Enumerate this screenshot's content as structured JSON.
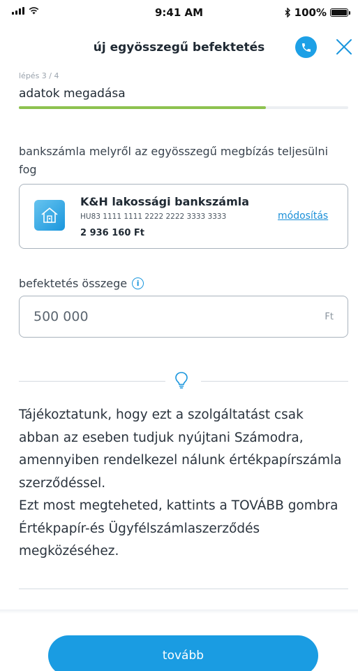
{
  "status_bar": {
    "time": "9:41 AM",
    "battery": "100%",
    "icons": [
      "signal-icon",
      "wifi-icon",
      "bluetooth-icon",
      "battery-icon"
    ]
  },
  "header": {
    "title": "új egyösszegű befektetés",
    "icons": [
      "phone-icon",
      "close-icon"
    ],
    "accent_color": "#1a9ce2"
  },
  "step": {
    "label": "lépés 3 / 4",
    "title": "adatok megadása",
    "progress": 0.75,
    "progress_color": "#8dc24f"
  },
  "account": {
    "label": "bankszámla melyről az egyösszegű megbízás teljesülni fog",
    "name": "K&H lakossági bankszámla",
    "iban": "HU83 1111 1111 2222 2222 3333 3333",
    "balance": "2 936 160 Ft",
    "modify_label": "módosítás",
    "icon": "house-account-icon"
  },
  "amount": {
    "label": "befektetés összege",
    "value": "500 000",
    "currency": "Ft",
    "icon": "info-icon"
  },
  "notice": {
    "icon": "lightbulb-icon",
    "text": "Tájékoztatunk, hogy ezt a szolgáltatást csak abban az eseben tudjuk nyújtani Számodra, amennyiben rendelkezel nálunk értékpapírszámla szerződéssel.\nEzt most megteheted, kattints a TOVÁBB gombra Értékpapír-és Ügyfélszámlaszerződés megközéséhez."
  },
  "footer": {
    "next_label": "tovább"
  }
}
